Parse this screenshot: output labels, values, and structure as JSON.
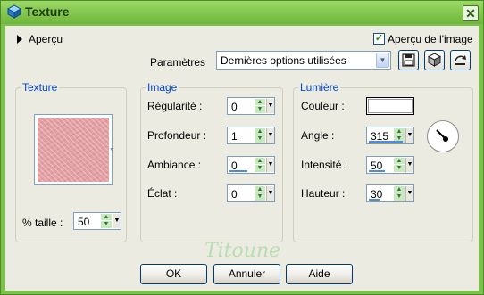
{
  "window": {
    "title": "Texture",
    "close_glyph": "✕"
  },
  "preview": {
    "label": "Aperçu",
    "checkbox_label": "Aperçu de l'image",
    "checkbox_checked": true
  },
  "presets": {
    "label": "Paramètres",
    "value": "Dernières options utilisées"
  },
  "texture_group": {
    "title": "Texture",
    "size_label": "% taille :",
    "size_value": "50"
  },
  "image_group": {
    "title": "Image",
    "fields": [
      {
        "label": "Régularité :",
        "value": "0"
      },
      {
        "label": "Profondeur :",
        "value": "1"
      },
      {
        "label": "Ambiance :",
        "value": "0"
      },
      {
        "label": "Éclat :",
        "value": "0"
      }
    ]
  },
  "light_group": {
    "title": "Lumière",
    "color_label": "Couleur :",
    "fields": [
      {
        "label": "Angle :",
        "value": "315"
      },
      {
        "label": "Intensité :",
        "value": "50"
      },
      {
        "label": "Hauteur :",
        "value": "30"
      }
    ]
  },
  "watermark": "Titoune",
  "buttons": {
    "ok": "OK",
    "cancel": "Annuler",
    "help": "Aide"
  }
}
